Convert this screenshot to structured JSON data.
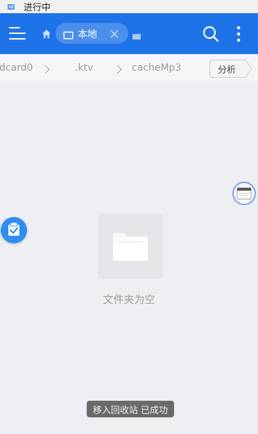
{
  "status_bar": {
    "text": "进行中"
  },
  "app_bar": {
    "location_label": "本地",
    "menu_icon": "menu-icon",
    "home_icon": "home-icon",
    "search_icon": "search-icon",
    "more_icon": "more-vertical-icon",
    "accent_color": "#1f73e8"
  },
  "breadcrumb": {
    "items": [
      {
        "label": "dcard0"
      },
      {
        "label": ".ktv"
      },
      {
        "label": "cacheMp3"
      }
    ],
    "analyze_label": "分析"
  },
  "main": {
    "empty_text": "文件夹为空",
    "folder_icon": "folder-icon"
  },
  "floating": {
    "left_icon": "checklist-icon",
    "right_icon": "window-thumbnail-icon"
  },
  "toast": {
    "text": "移入回收站 已成功"
  }
}
